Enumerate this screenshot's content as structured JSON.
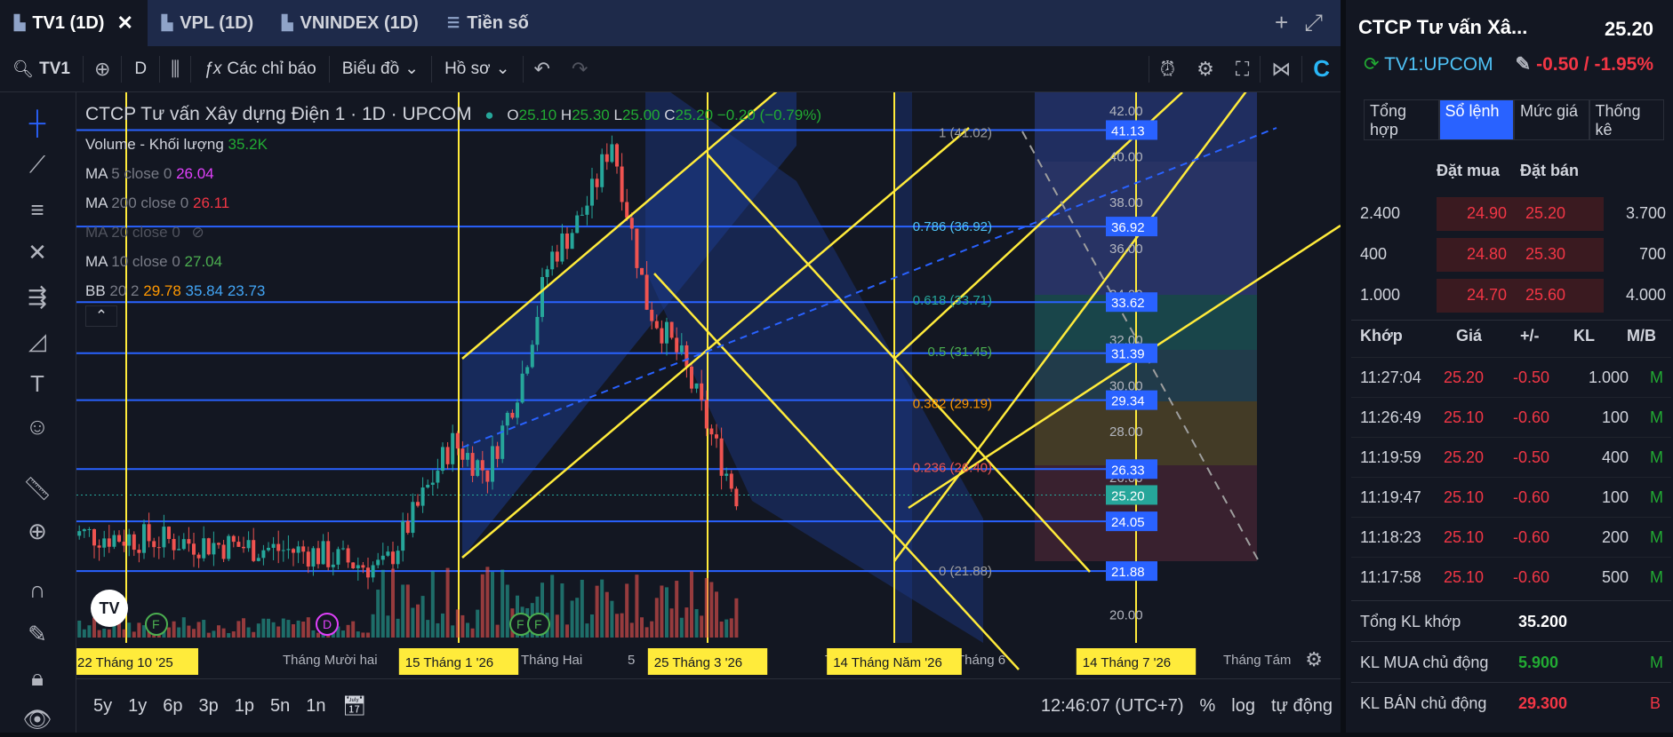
{
  "tabs": [
    {
      "label": "TV1 (1D)"
    },
    {
      "label": "VPL (1D)"
    },
    {
      "label": "VNINDEX (1D)"
    },
    {
      "label": "Tiền số"
    }
  ],
  "toolbar": {
    "symbol": "TV1",
    "interval": "D",
    "indicators": "Các chỉ báo",
    "chart_type": "Biểu đồ",
    "profile": "Hồ sơ"
  },
  "legend": {
    "title": "CTCP Tư vấn Xây dựng Điện 1 · 1D · UPCOM",
    "o_lbl": "O",
    "o": "25.10",
    "h_lbl": "H",
    "h": "25.30",
    "l_lbl": "L",
    "l": "25.00",
    "c_lbl": "C",
    "c": "25.20",
    "chg": "−0.20 (−0.79%)",
    "volume_lbl": "Volume - Khối lượng",
    "volume": "35.2K",
    "ma5_lbl": "MA",
    "ma5_p": "5 close 0",
    "ma5": "26.04",
    "ma200_lbl": "MA",
    "ma200_p": "200 close 0",
    "ma200": "26.11",
    "ma20_lbl": "MA",
    "ma20_p": "20 close 0",
    "ma10_lbl": "MA",
    "ma10_p": "10 close 0",
    "ma10": "27.04",
    "bb_lbl": "BB",
    "bb_p": "20 2",
    "bb1": "29.78",
    "bb2": "35.84",
    "bb3": "23.73"
  },
  "chart_data": {
    "type": "candlestick",
    "y_ticks": [
      "42.00",
      "40.00",
      "38.00",
      "36.00",
      "34.00",
      "32.00",
      "30.00",
      "28.00",
      "26.00",
      "24.00",
      "22.00",
      "20.00"
    ],
    "price_labels": [
      "41.13",
      "36.92",
      "33.62",
      "31.39",
      "29.34",
      "26.33",
      "25.20",
      "24.05",
      "21.88"
    ],
    "fib_levels": [
      "1 (41.02)",
      "0.786 (36.92)",
      "0.618 (33.71)",
      "0.5 (31.45)",
      "0.382 (29.19)",
      "0.236 (26.40)",
      "0 (21.88)"
    ],
    "x_ticks": [
      "11",
      "Tháng Mười hai",
      "2",
      "Tháng Hai",
      "5",
      "Th",
      "Tháng 6",
      "Tha",
      "Tháng Tám"
    ],
    "date_markers": [
      "22 Tháng 10 '25",
      "15 Tháng 1 '26",
      "25 Tháng 3 '26",
      "14 Tháng Năm '26",
      "14 Tháng 7 '26"
    ],
    "event_markers": [
      "F",
      "D",
      "F",
      "F"
    ],
    "colors": {
      "up": "#26a69a",
      "down": "#ef5350",
      "trend": "#ffeb3b",
      "level": "#2962ff"
    }
  },
  "bottom": {
    "ranges": [
      "5y",
      "1y",
      "6p",
      "3p",
      "1p",
      "5n",
      "1n"
    ],
    "time": "12:46:07 (UTC+7)",
    "pct": "%",
    "log": "log",
    "auto": "tự động"
  },
  "side": {
    "name": "CTCP Tư vấn Xâ...",
    "price": "25.20",
    "symbol": "TV1:UPCOM",
    "change": "-0.50 / -1.95%",
    "tabs": [
      "Tổng hợp",
      "Sổ lệnh",
      "Mức giá",
      "Thống kê"
    ],
    "ob_headers": {
      "bid": "Đặt mua",
      "ask": "Đặt bán"
    },
    "orderbook": [
      {
        "bq": "2.400",
        "bp": "24.90",
        "ap": "25.20",
        "aq": "3.700"
      },
      {
        "bq": "400",
        "bp": "24.80",
        "ap": "25.30",
        "aq": "700"
      },
      {
        "bq": "1.000",
        "bp": "24.70",
        "ap": "25.60",
        "aq": "4.000"
      }
    ],
    "trade_headers": {
      "t": "Khớp",
      "p": "Giá",
      "c": "+/-",
      "v": "KL",
      "s": "M/B"
    },
    "trades": [
      {
        "t": "11:27:04",
        "p": "25.20",
        "c": "-0.50",
        "v": "1.000",
        "s": "M"
      },
      {
        "t": "11:26:49",
        "p": "25.10",
        "c": "-0.60",
        "v": "100",
        "s": "M"
      },
      {
        "t": "11:19:59",
        "p": "25.20",
        "c": "-0.50",
        "v": "400",
        "s": "M"
      },
      {
        "t": "11:19:47",
        "p": "25.10",
        "c": "-0.60",
        "v": "100",
        "s": "M"
      },
      {
        "t": "11:18:23",
        "p": "25.10",
        "c": "-0.60",
        "v": "200",
        "s": "M"
      },
      {
        "t": "11:17:58",
        "p": "25.10",
        "c": "-0.60",
        "v": "500",
        "s": "M"
      }
    ],
    "summary": [
      {
        "label": "Tổng KL khớp",
        "value": "35.200",
        "flag": ""
      },
      {
        "label": "KL MUA chủ động",
        "value": "5.900",
        "flag": "M"
      },
      {
        "label": "KL BÁN chủ động",
        "value": "29.300",
        "flag": "B"
      }
    ]
  }
}
